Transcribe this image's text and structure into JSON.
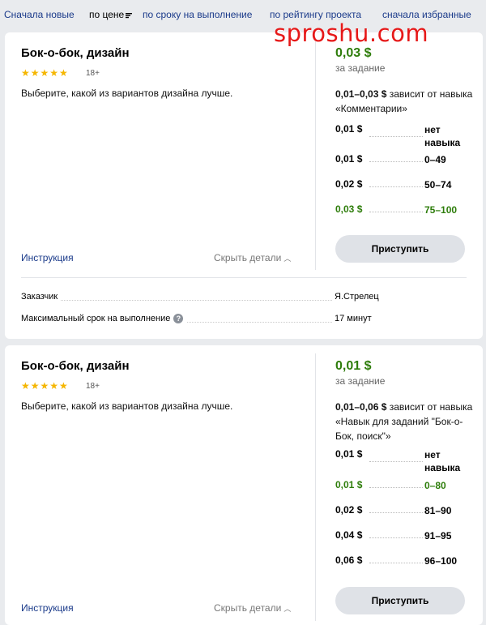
{
  "sort": {
    "newest": "Сначала новые",
    "price": "по цене",
    "deadline": "по сроку на выполнение",
    "rating": "по рейтингу проекта",
    "favorites": "сначала избранные"
  },
  "watermark": "sproshu.com",
  "cards": [
    {
      "title": "Бок-о-бок, дизайн",
      "stars": "★★★★★",
      "age": "18+",
      "description": "Выберите, какой из вариантов дизайна лучше.",
      "price": "0,03 $",
      "per_task": "за задание",
      "range": "0,01–0,03 $",
      "depends_text": " зависит от навыка «Комментарии»",
      "tiers": [
        {
          "price": "0,01 $",
          "range": "нет навыка",
          "highlight": false
        },
        {
          "price": "0,01 $",
          "range": "0–49",
          "highlight": false
        },
        {
          "price": "0,02 $",
          "range": "50–74",
          "highlight": false
        },
        {
          "price": "0,03 $",
          "range": "75–100",
          "highlight": true
        }
      ],
      "start_button": "Приступить",
      "instruction": "Инструкция",
      "hide_details": "Скрыть детали",
      "requester_label": "Заказчик",
      "requester_value": "Я.Стрелец",
      "deadline_label": "Максимальный срок на выполнение",
      "deadline_value": "17 минут"
    },
    {
      "title": "Бок-о-бок, дизайн",
      "stars": "★★★★★",
      "age": "18+",
      "description": "Выберите, какой из вариантов дизайна лучше.",
      "price": "0,01 $",
      "per_task": "за задание",
      "range": "0,01–0,06 $",
      "depends_text": " зависит от навыка «Навык для заданий \"Бок-о-Бок, поиск\"»",
      "tiers": [
        {
          "price": "0,01 $",
          "range": "нет навыка",
          "highlight": false
        },
        {
          "price": "0,01 $",
          "range": "0–80",
          "highlight": true
        },
        {
          "price": "0,02 $",
          "range": "81–90",
          "highlight": false
        },
        {
          "price": "0,04 $",
          "range": "91–95",
          "highlight": false
        },
        {
          "price": "0,06 $",
          "range": "96–100",
          "highlight": false
        }
      ],
      "start_button": "Приступить",
      "instruction": "Инструкция",
      "hide_details": "Скрыть детали"
    }
  ],
  "colors": {
    "accent_green": "#2e7d0b",
    "link_blue": "#1a3a8a",
    "star_yellow": "#f5b600",
    "watermark_red": "#e61919"
  }
}
